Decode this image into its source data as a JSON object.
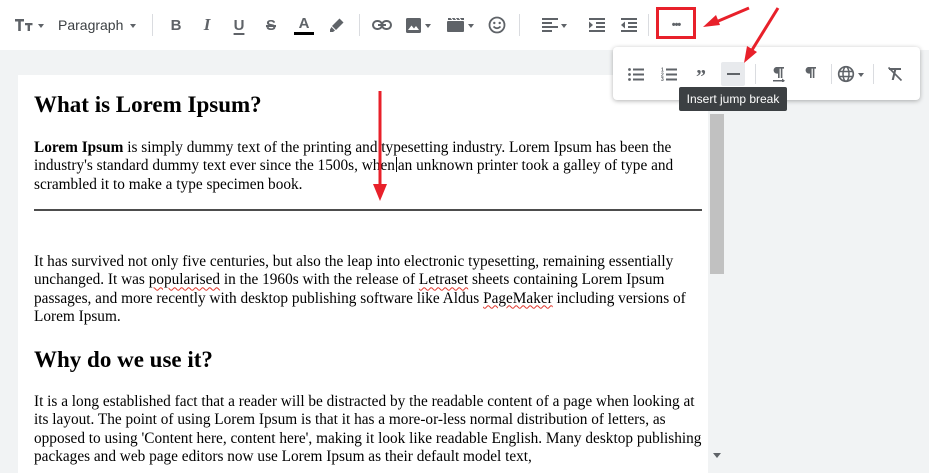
{
  "toolbar": {
    "paragraph_label": "Paragraph",
    "bold_label": "B",
    "italic_label": "I",
    "underline_label": "U",
    "strike_label": "S",
    "text_color_label": "A",
    "text_color": "#000000",
    "more_label": "•••"
  },
  "more_menu": {
    "quote_label": "”",
    "tooltip": "Insert jump break"
  },
  "document": {
    "h1": "What is Lorem Ipsum?",
    "p1": {
      "bold": "Lorem Ipsum",
      "text_a": " is simply dummy text of the printing and typesetting industry. Lorem Ipsum has been the industry's standard dummy text ever since the 1500s, when",
      "text_b": "an unknown printer took a galley of type and scrambled it to make a type specimen book."
    },
    "p2": {
      "a": "It has survived not only five centuries, but also the leap into electronic typesetting, remaining essentially unchanged. It was ",
      "popularised": "popularised",
      "b": " in the 1960s with the release of ",
      "letraset": "Letraset",
      "c": " sheets containing Lorem Ipsum passages, and more recently with desktop publishing software like Aldus ",
      "pagemaker": "PageMaker",
      "d": " including versions of Lorem Ipsum."
    },
    "h2": "Why do we use it?",
    "p3": "It is a long established fact that a reader will be distracted by the readable content of a page when looking at its layout. The point of using Lorem Ipsum is that it has a more-or-less normal distribution of letters, as opposed to using 'Content here, content here', making it look like readable English. Many desktop publishing packages and web page editors now use Lorem Ipsum as their default model text,"
  },
  "colors": {
    "annotation": "#e8202a",
    "spellcheck": "#e0352b",
    "toolbar_icon": "#5f6368"
  }
}
